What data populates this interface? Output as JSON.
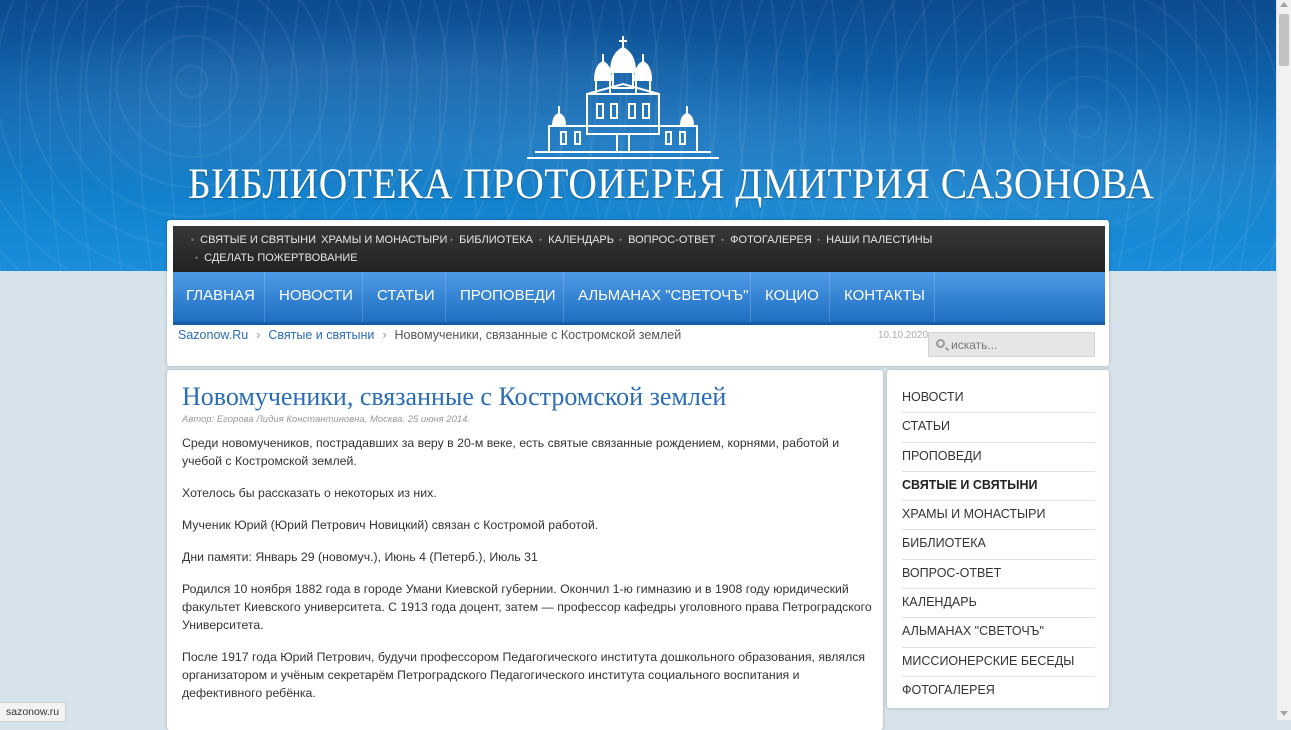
{
  "site": {
    "title": "БИБЛИОТЕКА ПРОТОИЕРЕЯ ДМИТРИЯ САЗОНОВА",
    "logo_icon": "church-icon"
  },
  "topnav": {
    "items": [
      "СВЯТЫЕ И СВЯТЫНИ",
      "ХРАМЫ И МОНАСТЫРИ",
      "БИБЛИОТЕКА",
      "КАЛЕНДАРЬ",
      "ВОПРОС-ОТВЕТ",
      "ФОТОГАЛЕРЕЯ",
      "НАШИ ПАЛЕСТИНЫ",
      "СДЕЛАТЬ ПОЖЕРТВОВАНИЕ"
    ]
  },
  "mainnav": {
    "items": [
      "ГЛАВНАЯ",
      "НОВОСТИ",
      "СТАТЬИ",
      "ПРОПОВЕДИ",
      "АЛЬМАНАХ \"СВЕТОЧЪ\"",
      "КОЦИО",
      "КОНТАКТЫ"
    ]
  },
  "breadcrumb": {
    "items": [
      "Sazonow.Ru",
      "Святые и святыни",
      "Новомученики, связанные с Костромской землей"
    ]
  },
  "date": "10.10.2020",
  "search": {
    "placeholder": "искать..."
  },
  "article": {
    "title": "Новомученики, связанные с Костромской землей",
    "meta": "Автор: Егорова Лидия Константиновна, Москва. 25 июня 2014.",
    "paragraphs": [
      "Среди новомучеников, пострадавших за веру в 20-м веке, есть святые связанные рождением, корнями, работой и учебой с Костромской землей.",
      "Хотелось бы рассказать о некоторых из них.",
      "Мученик Юрий (Юрий Петрович Новицкий) связан с Костромой работой.",
      "Дни памяти: Январь 29 (новомуч.), Июнь 4 (Петерб.), Июль 31",
      "Родился 10 ноября 1882 года в городе Умани Киевской губернии. Окончил 1-ю гимназию и в 1908 году юридический факультет Киевского университета. С 1913 года доцент, затем — профессор кафедры уголовного права Петроградского Университета.",
      "После 1917 года Юрий Петрович, будучи профессором Педагогического института дошкольного образования, являлся организатором и учёным секретарём Петроградского Педагогического института социального воспитания и дефективного ребёнка."
    ]
  },
  "sidebar": {
    "items": [
      "НОВОСТИ",
      "СТАТЬИ",
      "ПРОПОВЕДИ",
      "СВЯТЫЕ И СВЯТЫНИ",
      "ХРАМЫ И МОНАСТЫРИ",
      "БИБЛИОТЕКА",
      "ВОПРОС-ОТВЕТ",
      "КАЛЕНДАРЬ",
      "АЛЬМАНАХ \"СВЕТОЧЪ\"",
      "МИССИОНЕРСКИЕ БЕСЕДЫ",
      "ФОТОГАЛЕРЕЯ"
    ],
    "active": "СВЯТЫЕ И СВЯТЫНИ"
  },
  "status_bar": "sazonow.ru"
}
